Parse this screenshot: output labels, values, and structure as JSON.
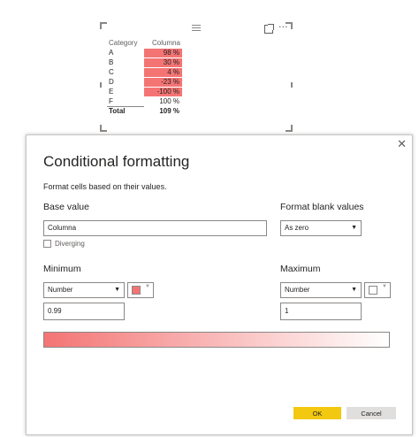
{
  "visual": {
    "headers": [
      "Category",
      "Columna"
    ],
    "rows": [
      {
        "category": "A",
        "value": "98 %",
        "shaded": true
      },
      {
        "category": "B",
        "value": "30 %",
        "shaded": true
      },
      {
        "category": "C",
        "value": "4 %",
        "shaded": true
      },
      {
        "category": "D",
        "value": "-23 %",
        "shaded": true
      },
      {
        "category": "E",
        "value": "-100 %",
        "shaded": true
      },
      {
        "category": "F",
        "value": "100 %",
        "shaded": false
      }
    ],
    "total": {
      "label": "Total",
      "value": "109 %"
    },
    "more_icon": "···",
    "shade_color": "#f47474"
  },
  "dialog": {
    "close": "✕",
    "title": "Conditional formatting",
    "subtitle": "Format cells based on their values.",
    "base_value_label": "Base value",
    "base_value": "Columna",
    "blank_label": "Format blank values",
    "blank_value": "As zero",
    "diverging_label": "Diverging",
    "minimum_label": "Minimum",
    "maximum_label": "Maximum",
    "min_type": "Number",
    "max_type": "Number",
    "min_value": "0.99",
    "max_value": "1",
    "min_color": "#f47474",
    "max_color": "#ffffff",
    "ok": "OK",
    "cancel": "Cancel",
    "ok_color": "#f2c811"
  }
}
